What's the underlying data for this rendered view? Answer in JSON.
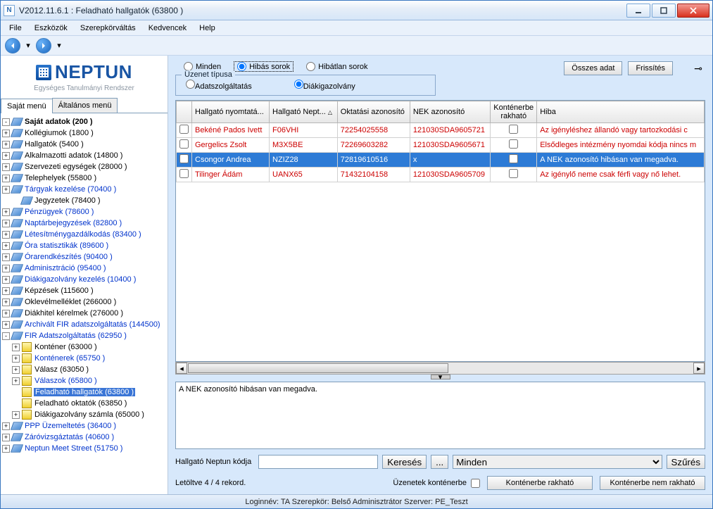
{
  "window": {
    "title": "V2012.11.6.1 : Feladható hallgatók (63800  )"
  },
  "menu": [
    "File",
    "Eszközök",
    "Szerepkörváltás",
    "Kedvencek",
    "Help"
  ],
  "logo": {
    "title": "NEPTUN",
    "subtitle": "Egységes Tanulmányi Rendszer"
  },
  "tabs": {
    "active": "Saját menü",
    "other": "Általános menü"
  },
  "tree": [
    {
      "label": "Saját adatok (200  )",
      "bold": true,
      "exp": "-",
      "ic": "d"
    },
    {
      "label": "Kollégiumok (1800  )",
      "exp": "+",
      "ic": "d"
    },
    {
      "label": "Hallgatók (5400  )",
      "exp": "+",
      "ic": "d"
    },
    {
      "label": "Alkalmazotti adatok (14800  )",
      "exp": "+",
      "ic": "d"
    },
    {
      "label": "Szervezeti egységek (28000  )",
      "exp": "+",
      "ic": "d"
    },
    {
      "label": "Telephelyek (55800  )",
      "exp": "+",
      "ic": "d"
    },
    {
      "label": "Tárgyak kezelése (70400  )",
      "exp": "+",
      "ic": "d",
      "blue": true
    },
    {
      "label": "Jegyzetek (78400  )",
      "ind": true,
      "ic": "d"
    },
    {
      "label": "Pénzügyek (78600  )",
      "exp": "+",
      "ic": "d",
      "blue": true
    },
    {
      "label": "Naptárbejegyzések (82800  )",
      "exp": "+",
      "ic": "d",
      "blue": true
    },
    {
      "label": "Létesítménygazdálkodás (83400  )",
      "exp": "+",
      "ic": "d",
      "blue": true
    },
    {
      "label": "Óra statisztikák (89600  )",
      "exp": "+",
      "ic": "d",
      "blue": true
    },
    {
      "label": "Órarendkészítés (90400  )",
      "exp": "+",
      "ic": "d",
      "blue": true
    },
    {
      "label": "Adminisztráció (95400  )",
      "exp": "+",
      "ic": "d",
      "blue": true
    },
    {
      "label": "Diákigazolvány kezelés (10400  )",
      "exp": "+",
      "ic": "d",
      "blue": true
    },
    {
      "label": "Képzések (115600  )",
      "exp": "+",
      "ic": "d"
    },
    {
      "label": "Oklevélmelléklet (266000  )",
      "exp": "+",
      "ic": "d"
    },
    {
      "label": "Diákhitel kérelmek (276000  )",
      "exp": "+",
      "ic": "d"
    },
    {
      "label": "Archivált FIR adatszolgáltatás (144500)",
      "exp": "+",
      "ic": "d",
      "blue": true
    },
    {
      "label": "FIR Adatszolgáltatás (62950  )",
      "exp": "-",
      "ic": "d",
      "blue": true
    },
    {
      "label": "Konténer (63000  )",
      "exp": "+",
      "ind": true,
      "ic": "f"
    },
    {
      "label": "Konténerek (65750  )",
      "exp": "+",
      "ind": true,
      "ic": "f",
      "blue": true
    },
    {
      "label": "Válasz (63050  )",
      "exp": "+",
      "ind": true,
      "ic": "f"
    },
    {
      "label": "Válaszok (65800  )",
      "exp": "+",
      "ind": true,
      "ic": "f",
      "blue": true
    },
    {
      "label": "Feladható hallgatók (63800  )",
      "ind": true,
      "ic": "f",
      "sel": true,
      "noexp": true
    },
    {
      "label": "Feladható oktatók (63850  )",
      "ind": true,
      "ic": "f",
      "noexp": true
    },
    {
      "label": "Diákigazolvány számla (65000  )",
      "exp": "+",
      "ind": true,
      "ic": "f"
    },
    {
      "label": "PPP Üzemeltetés (36400  )",
      "exp": "+",
      "ic": "d",
      "blue": true
    },
    {
      "label": "Záróvizsgáztatás (40600  )",
      "exp": "+",
      "ic": "d",
      "blue": true
    },
    {
      "label": "Neptun Meet Street (51750  )",
      "exp": "+",
      "ic": "d",
      "blue": true
    }
  ],
  "filter": {
    "all": "Minden",
    "err": "Hibás sorok",
    "ok": "Hibátlan sorok",
    "fieldset_title": "Üzenet típusa",
    "opt1": "Adatszolgáltatás",
    "opt2": "Diákigazolvány"
  },
  "topbuttons": {
    "all": "Összes adat",
    "refresh": "Frissítés"
  },
  "grid": {
    "headers": [
      "",
      "Hallgató nyomtatá...",
      "Hallgató Nept...",
      "Oktatási azonosító",
      "NEK azonosító",
      "Konténerbe rakható",
      "Hiba"
    ],
    "rows": [
      {
        "c": [
          "",
          "Bekéné Pados Ivett",
          "F06VHI",
          "72254025558",
          "121030SDA9605721",
          "",
          "Az igényléshez állandó vagy tartozkodási c"
        ],
        "sel": false
      },
      {
        "c": [
          "",
          "Gergelics Zsolt",
          "M3X5BE",
          "72269603282",
          "121030SDA9605671",
          "",
          "Elsődleges intézmény nyomdai kódja nincs m"
        ],
        "sel": false
      },
      {
        "c": [
          "",
          "Csongor Andrea",
          "NZIZ28",
          "72819610516",
          "x",
          "",
          "A NEK azonosító hibásan van megadva."
        ],
        "sel": true
      },
      {
        "c": [
          "",
          "Tilinger Ádám",
          "UANX65",
          "71432104158",
          "121030SDA9605709",
          "",
          "Az igénylő neme csak férfi vagy nő lehet."
        ],
        "sel": false
      }
    ]
  },
  "detail": "A NEK azonosító hibásan van megadva.",
  "search": {
    "label": "Hallgató Neptun kódja",
    "btn": "Keresés",
    "dots": "...",
    "sel": "Minden",
    "filterbtn": "Szűrés"
  },
  "bottom": {
    "count": "Letöltve 4 / 4 rekord.",
    "chklabel": "Üzenetek konténerbe",
    "b1": "Konténerbe rakható",
    "b2": "Konténerbe nem rakható"
  },
  "status": "Loginnév: TA   Szerepkör: Belső Adminisztrátor   Szerver: PE_Teszt"
}
